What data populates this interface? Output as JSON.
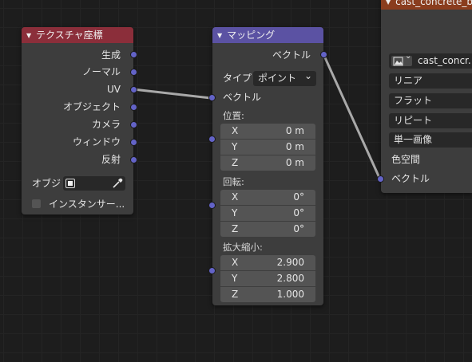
{
  "texcoord": {
    "title": "テクスチャ座標",
    "header_color": "#8b2e3a",
    "outputs": [
      "生成",
      "ノーマル",
      "UV",
      "オブジェクト",
      "カメラ",
      "ウィンドウ",
      "反射"
    ],
    "object_label": "オブジ",
    "instancer_label": "インスタンサー..."
  },
  "mapping": {
    "title": "マッピング",
    "header_color": "#5b52a3",
    "output_label": "ベクトル",
    "type_label": "タイプ",
    "type_value": "ポイント",
    "vector_input": "ベクトル",
    "location_label": "位置:",
    "location": [
      {
        "axis": "X",
        "value": "0 m"
      },
      {
        "axis": "Y",
        "value": "0 m"
      },
      {
        "axis": "Z",
        "value": "0 m"
      }
    ],
    "rotation_label": "回転:",
    "rotation": [
      {
        "axis": "X",
        "value": "0°"
      },
      {
        "axis": "Y",
        "value": "0°"
      },
      {
        "axis": "Z",
        "value": "0°"
      }
    ],
    "scale_label": "拡大縮小:",
    "scale": [
      {
        "axis": "X",
        "value": "2.900"
      },
      {
        "axis": "Y",
        "value": "2.800"
      },
      {
        "axis": "Z",
        "value": "1.000"
      }
    ]
  },
  "image": {
    "title": "cast_concrete_b",
    "header_color": "#8a3d1e",
    "image_name": "cast_concr...",
    "interpolation": "リニア",
    "projection": "フラット",
    "extension": "リピート",
    "source": "単一画像",
    "colorspace_label": "色空間",
    "vector_input": "ベクトル"
  },
  "colors": {
    "socket_vector": "#6363c7",
    "link": "#a9a9a9"
  },
  "icons": {
    "collapse": "▼",
    "dropdown": "⌄",
    "eyedropper": "eyedropper-icon",
    "image": "image-icon",
    "object": "object-icon"
  }
}
